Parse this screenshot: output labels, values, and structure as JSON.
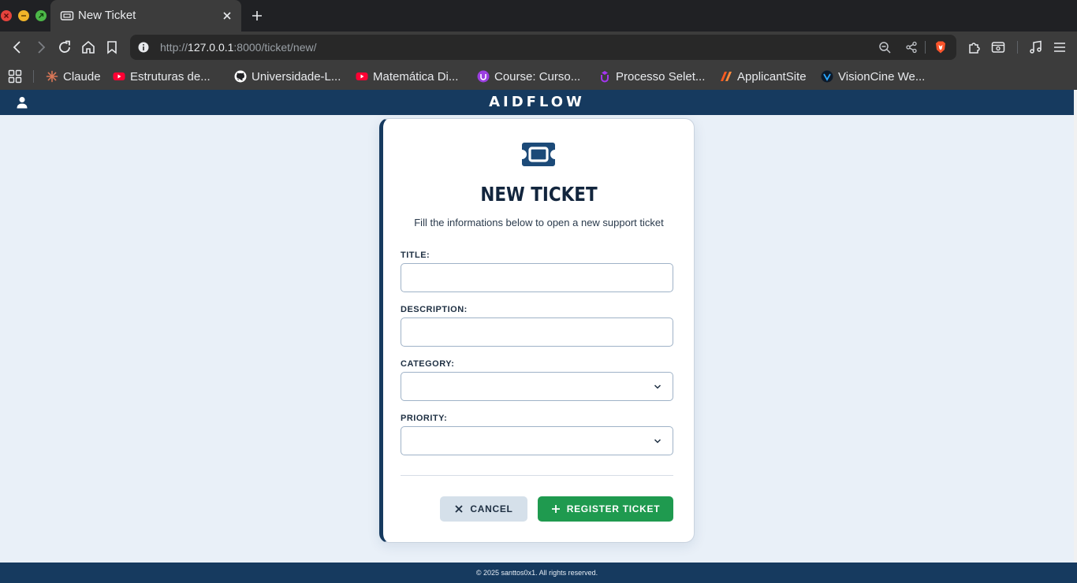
{
  "browser": {
    "tab_title": "New Ticket",
    "url_scheme": "http://",
    "url_host": "127.0.0.1",
    "url_path": ":8000/ticket/new/",
    "bookmarks": [
      {
        "label": "Claude",
        "icon": "claude-icon",
        "color": "#d97757"
      },
      {
        "label": "Estruturas de...",
        "icon": "youtube-icon",
        "color": "#ff0033"
      },
      {
        "label": "Universidade-L...",
        "icon": "github-icon",
        "color": "#ffffff"
      },
      {
        "label": "Matemática Di...",
        "icon": "youtube-icon",
        "color": "#ff0033"
      },
      {
        "label": "Course: Curso...",
        "icon": "course-icon",
        "color": "#9b3ee0"
      },
      {
        "label": "Processo Selet...",
        "icon": "udemy-icon",
        "color": "#a435f0"
      },
      {
        "label": "ApplicantSite",
        "icon": "applicant-icon",
        "color": "#ff5a1f"
      },
      {
        "label": "VisionCine We...",
        "icon": "visioncine-icon",
        "color": "#2aa7ff"
      }
    ]
  },
  "app": {
    "brand": "AIDFLOW",
    "colors": {
      "primary": "#163a5f",
      "success": "#1f9a4f",
      "cancel_bg": "#d5e0ea",
      "background": "#e9f0f8"
    }
  },
  "form": {
    "title": "NEW TICKET",
    "subtitle": "Fill the informations below to open a new support ticket",
    "fields": {
      "title": {
        "label": "TITLE:",
        "value": ""
      },
      "description": {
        "label": "DESCRIPTION:",
        "value": ""
      },
      "category": {
        "label": "CATEGORY:",
        "value": ""
      },
      "priority": {
        "label": "PRIORITY:",
        "value": ""
      }
    },
    "cancel_label": "CANCEL",
    "register_label": "REGISTER TICKET"
  },
  "footer": {
    "text": "© 2025 santtos0x1. All rights reserved."
  }
}
